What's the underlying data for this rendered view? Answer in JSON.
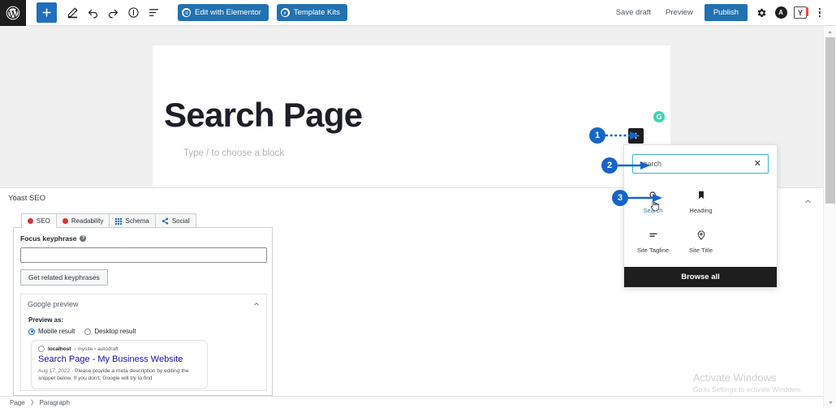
{
  "topbar": {
    "logo_icon": "wordpress-icon",
    "tools": [
      {
        "name": "add-block-button",
        "icon": "plus-icon"
      },
      {
        "name": "edit-tools-button",
        "icon": "pencil-icon"
      },
      {
        "name": "undo-button",
        "icon": "undo-icon"
      },
      {
        "name": "redo-button",
        "icon": "redo-icon"
      },
      {
        "name": "details-button",
        "icon": "info-icon"
      },
      {
        "name": "list-view-button",
        "icon": "list-view-icon"
      }
    ],
    "elementor_label": "Edit with Elementor",
    "template_kits_label": "Template Kits",
    "save_draft_label": "Save draft",
    "preview_label": "Preview",
    "publish_label": "Publish",
    "settings_icon": "gear-icon",
    "avatar_letter": "A",
    "yoast_letter": "Y",
    "options_icon": "kebab-menu-icon",
    "accent_blue": "#2271b1"
  },
  "editor": {
    "page_title": "Search Page",
    "block_placeholder": "Type / to choose a block",
    "green_badge_letter": "G",
    "green_badge_color": "#3dd5b0"
  },
  "inserter": {
    "plus_icon": "plus-icon",
    "search_value": "search",
    "search_clear_icon": "close-icon",
    "blocks": [
      {
        "label": "Search",
        "icon": "search-icon",
        "active": true
      },
      {
        "label": "Heading",
        "icon": "heading-pin-icon",
        "active": false
      },
      {
        "label": "Site Tagline",
        "icon": "site-tagline-icon",
        "active": false
      },
      {
        "label": "Site Title",
        "icon": "map-pin-icon",
        "active": false
      }
    ],
    "browse_all_label": "Browse all"
  },
  "annotations": [
    {
      "number": "1"
    },
    {
      "number": "2"
    },
    {
      "number": "3"
    }
  ],
  "yoast": {
    "heading": "Yoast SEO",
    "collapse_icon": "chevron-up-icon",
    "tabs": [
      {
        "label": "SEO",
        "icon": "red-dot-icon",
        "selected": true
      },
      {
        "label": "Readability",
        "icon": "red-dot-icon",
        "selected": false
      },
      {
        "label": "Schema",
        "icon": "grid-icon",
        "selected": false
      },
      {
        "label": "Social",
        "icon": "share-icon",
        "selected": false
      }
    ],
    "focus_keyphrase_label": "Focus keyphrase",
    "focus_keyphrase_help": "?",
    "focus_keyphrase_value": "",
    "get_related_label": "Get related keyphrases",
    "google_preview": {
      "title": "Google preview",
      "collapse_icon": "chevron-up-icon",
      "preview_as_label": "Preview as:",
      "options": [
        {
          "label": "Mobile result",
          "selected": true
        },
        {
          "label": "Desktop result",
          "selected": false
        }
      ],
      "snippet": {
        "domain": "localhost",
        "breadcrumb": "› mysite › autodraft",
        "title": "Search Page - My Business Website",
        "date": "Aug 17, 2022",
        "description": "Please provide a meta description by editing the snippet below. If you don't, Google will try to find"
      }
    }
  },
  "bottombar": {
    "crumbs": [
      "Page",
      "Paragraph"
    ],
    "separator": "❯"
  },
  "watermark": {
    "line1": "Activate Windows",
    "line2": "Go to Settings to activate Windows."
  },
  "scrollbar": {
    "up_icon": "chevron-up-icon",
    "down_icon": "chevron-down-icon"
  }
}
